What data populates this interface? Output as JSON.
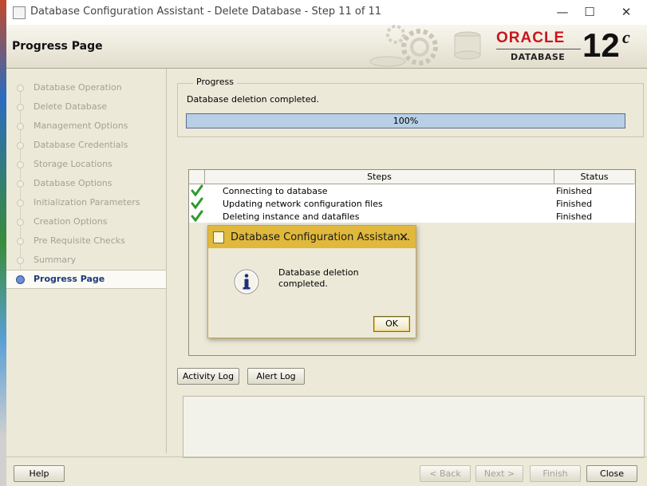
{
  "window": {
    "title": "Database Configuration Assistant - Delete Database - Step 11 of 11",
    "minimize_glyph": "—",
    "maximize_glyph": "☐",
    "close_glyph": "✕"
  },
  "header": {
    "page_title": "Progress Page",
    "logo_brand": "ORACLE",
    "logo_sub": "DATABASE",
    "logo_version": "12",
    "logo_version_suffix": "c"
  },
  "sidebar": {
    "items": [
      {
        "label": "Database Operation"
      },
      {
        "label": "Delete Database"
      },
      {
        "label": "Management Options"
      },
      {
        "label": "Database Credentials"
      },
      {
        "label": "Storage Locations"
      },
      {
        "label": "Database Options"
      },
      {
        "label": "Initialization Parameters"
      },
      {
        "label": "Creation Options"
      },
      {
        "label": "Pre Requisite Checks"
      },
      {
        "label": "Summary"
      },
      {
        "label": "Progress Page"
      }
    ],
    "active_index": 10
  },
  "progress": {
    "legend": "Progress",
    "message": "Database deletion completed.",
    "percent": 100,
    "percent_label": "100%"
  },
  "steps_table": {
    "headers": {
      "steps": "Steps",
      "status": "Status"
    },
    "rows": [
      {
        "step": "Connecting to database",
        "status": "Finished"
      },
      {
        "step": "Updating network configuration files",
        "status": "Finished"
      },
      {
        "step": "Deleting instance and datafiles",
        "status": "Finished"
      }
    ]
  },
  "dialog": {
    "title": "Database Configuration Assistan...",
    "close_glyph": "✕",
    "icon": "info-icon",
    "message_line1": "Database deletion",
    "message_line2": "completed.",
    "ok_label": "OK"
  },
  "buttons": {
    "activity_log": "Activity Log",
    "alert_log": "Alert Log",
    "help": "Help",
    "back": "< Back",
    "next": "Next >",
    "finish": "Finish",
    "close": "Close"
  },
  "colors": {
    "accent_blue": "#b8cfe6",
    "dialog_title": "#e0b83c",
    "oracle_red": "#c7161d"
  }
}
